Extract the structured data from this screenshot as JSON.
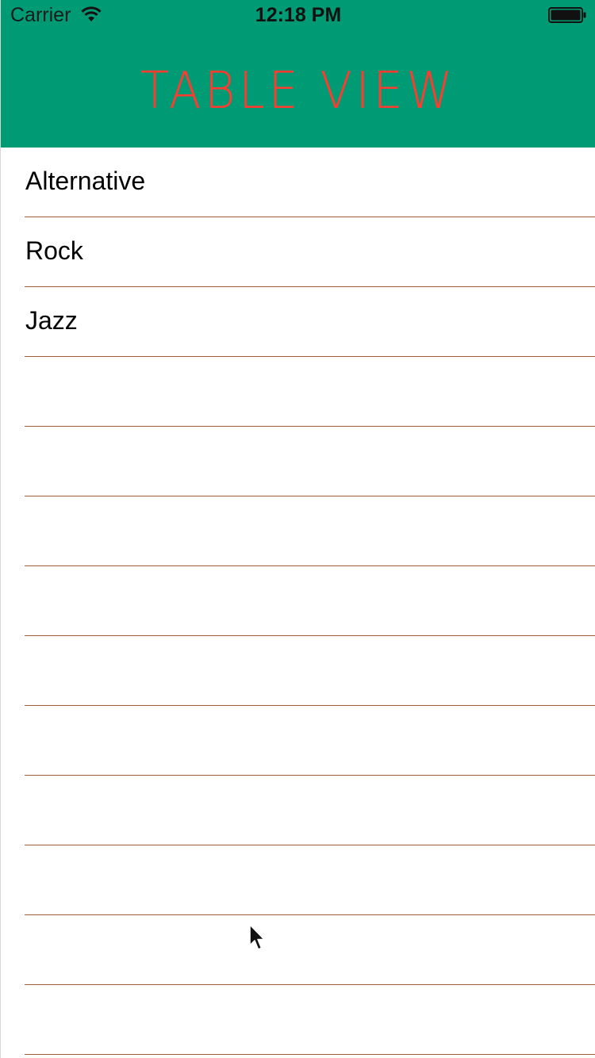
{
  "status_bar": {
    "carrier": "Carrier",
    "time": "12:18 PM",
    "wifi_icon": "wifi-icon",
    "battery_icon": "battery-icon"
  },
  "nav_bar": {
    "title": "TABLE VIEW",
    "background_color": "#009B74",
    "title_color": "#FF3B30"
  },
  "table": {
    "separator_color": "#A65A3E",
    "rows": [
      {
        "label": "Alternative"
      },
      {
        "label": "Rock"
      },
      {
        "label": "Jazz"
      },
      {
        "label": ""
      },
      {
        "label": ""
      },
      {
        "label": ""
      },
      {
        "label": ""
      },
      {
        "label": ""
      },
      {
        "label": ""
      },
      {
        "label": ""
      },
      {
        "label": ""
      },
      {
        "label": ""
      },
      {
        "label": ""
      }
    ]
  },
  "cursor": {
    "icon": "mouse-pointer-icon"
  }
}
